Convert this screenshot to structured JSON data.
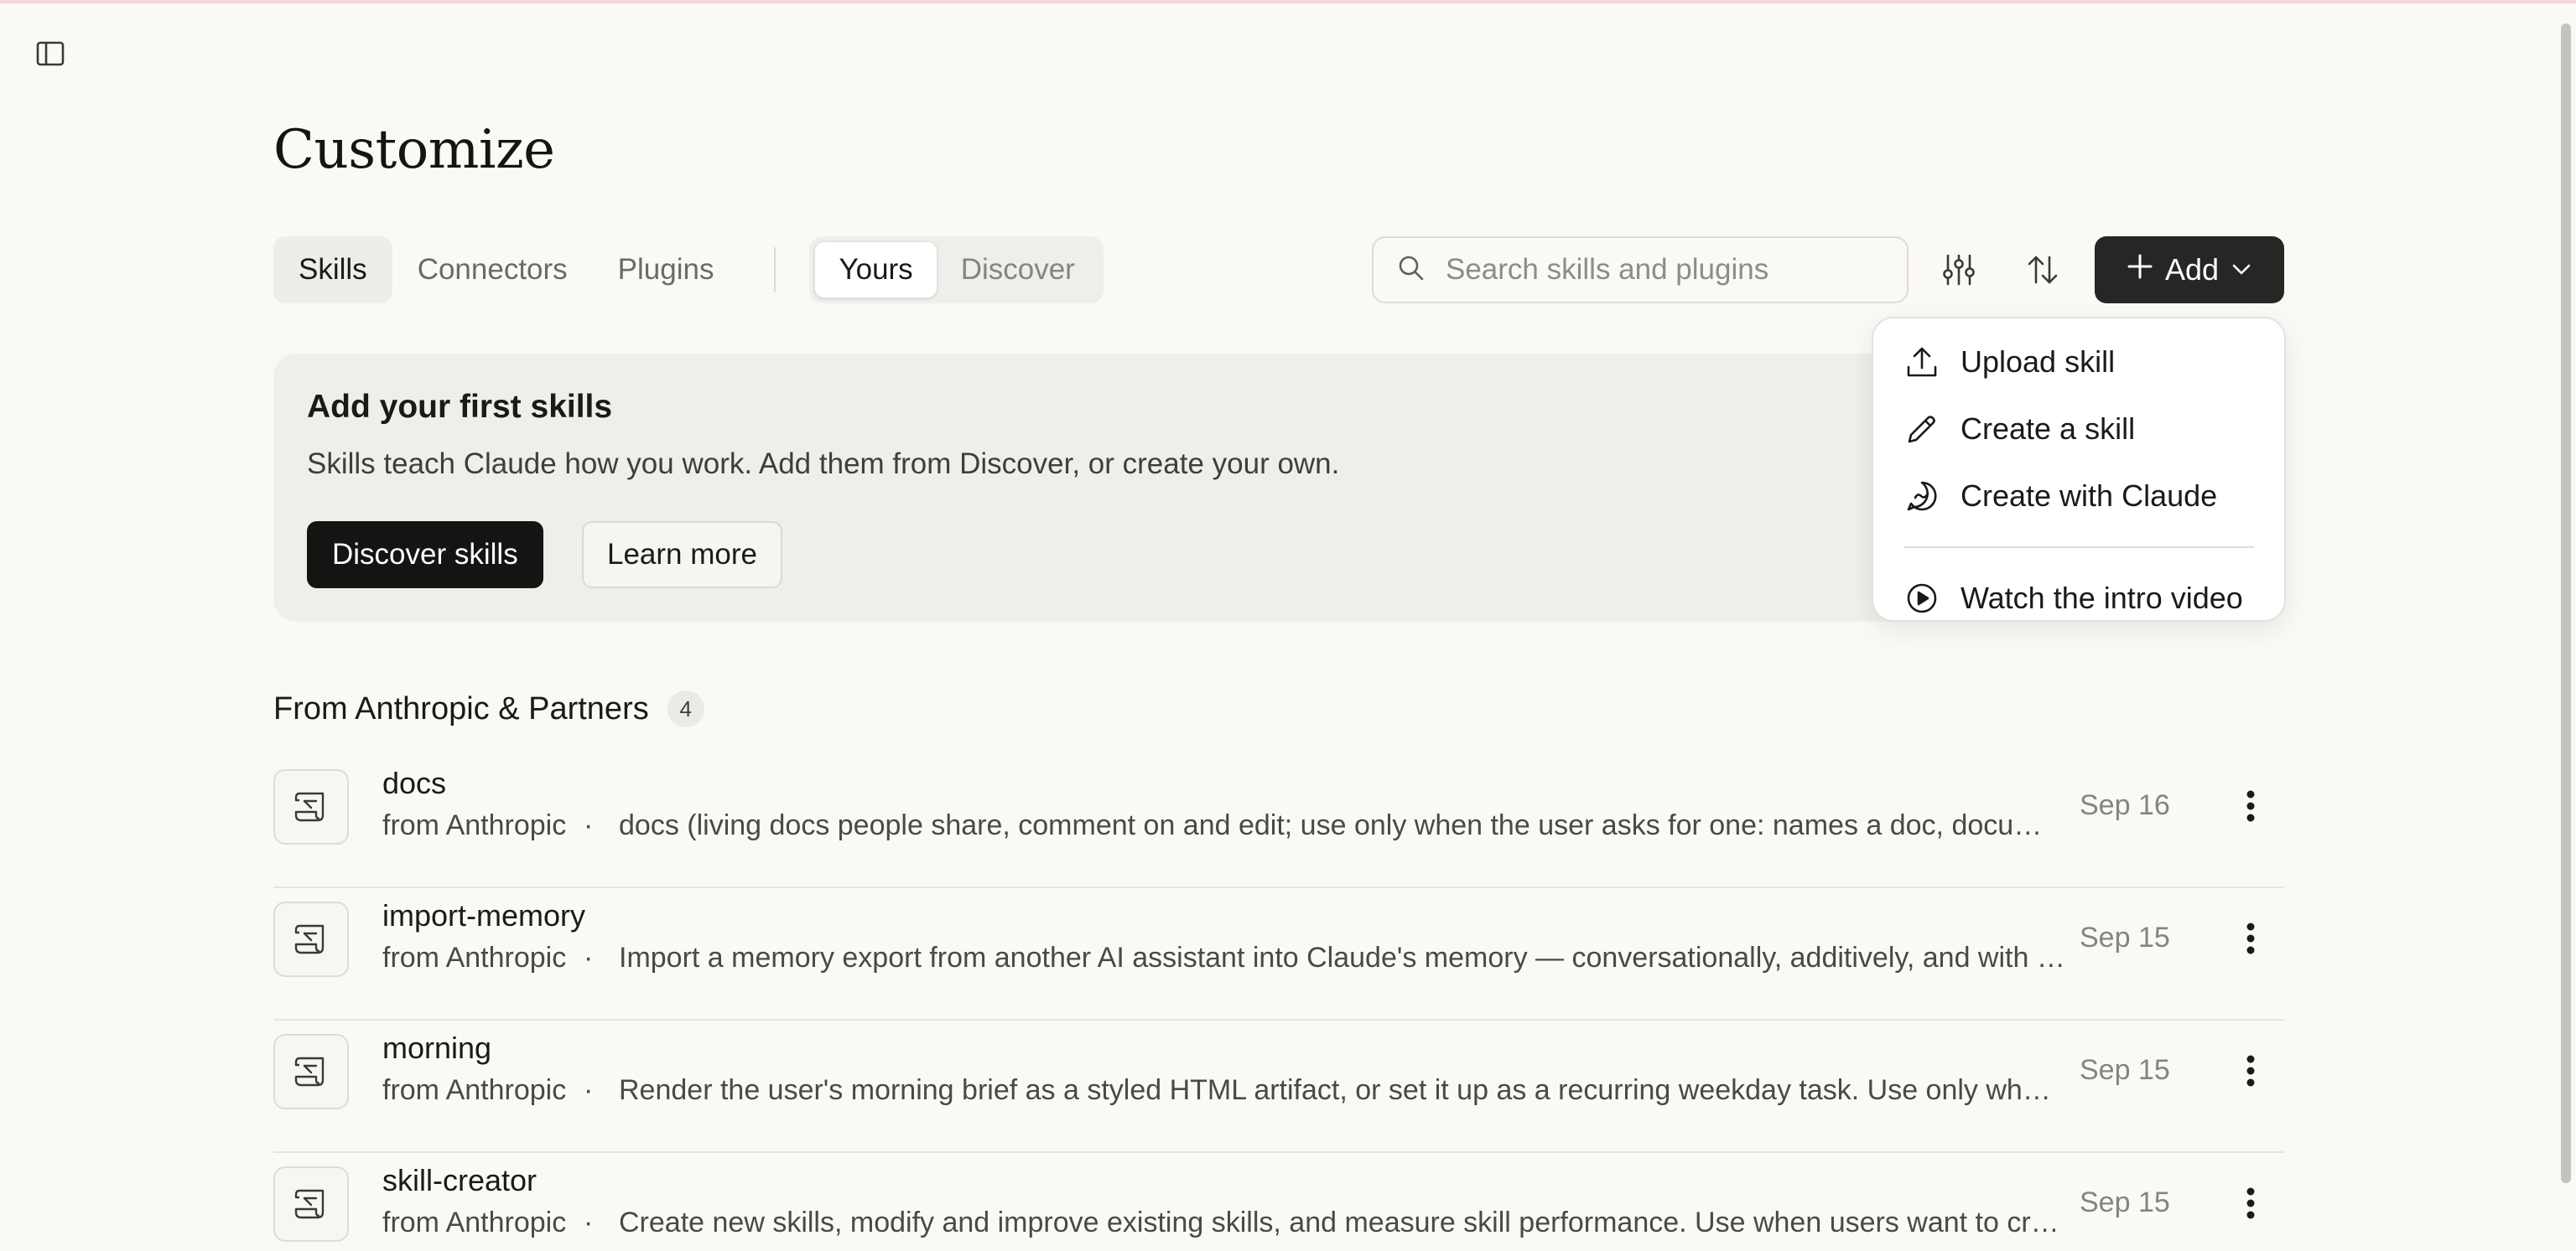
{
  "page": {
    "title": "Customize"
  },
  "tabs": [
    {
      "label": "Skills",
      "active": true
    },
    {
      "label": "Connectors",
      "active": false
    },
    {
      "label": "Plugins",
      "active": false
    }
  ],
  "segmented": [
    {
      "label": "Yours",
      "active": true
    },
    {
      "label": "Discover",
      "active": false
    }
  ],
  "search": {
    "placeholder": "Search skills and plugins",
    "value": ""
  },
  "toolbar": {
    "add_label": "Add"
  },
  "banner": {
    "title": "Add your first skills",
    "description": "Skills teach Claude how you work. Add them from Discover, or create your own.",
    "primary_label": "Discover skills",
    "secondary_label": "Learn more"
  },
  "add_menu": {
    "items": [
      {
        "label": "Upload skill",
        "icon": "upload-icon"
      },
      {
        "label": "Create a skill",
        "icon": "pencil-icon"
      },
      {
        "label": "Create with Claude",
        "icon": "chat-bubble-icon"
      },
      {
        "label": "Watch the intro video",
        "icon": "play-circle-icon"
      }
    ]
  },
  "section": {
    "title": "From Anthropic & Partners",
    "count": "4"
  },
  "skills": [
    {
      "name": "docs",
      "source": "from Anthropic",
      "separator": "·",
      "description": "docs (living docs people share, comment on and edit; use only when the user asks for one: names a doc, document, page or similar)",
      "date": "Sep 16"
    },
    {
      "name": "import-memory",
      "source": "from Anthropic",
      "separator": "·",
      "description": "Import a memory export from another AI assistant into Claude's memory — conversationally, additively, and with care",
      "date": "Sep 15"
    },
    {
      "name": "morning",
      "source": "from Anthropic",
      "separator": "·",
      "description": "Render the user's morning brief as a styled HTML artifact, or set it up as a recurring weekday task. Use only when asked",
      "date": "Sep 15"
    },
    {
      "name": "skill-creator",
      "source": "from Anthropic",
      "separator": "·",
      "description": "Create new skills, modify and improve existing skills, and measure skill performance. Use when users want to create a skill",
      "date": "Sep 15"
    }
  ],
  "colors": {
    "background": "#faf9f6",
    "add_button": "#262624",
    "primary_button": "#141413",
    "banner": "#efeeea"
  }
}
